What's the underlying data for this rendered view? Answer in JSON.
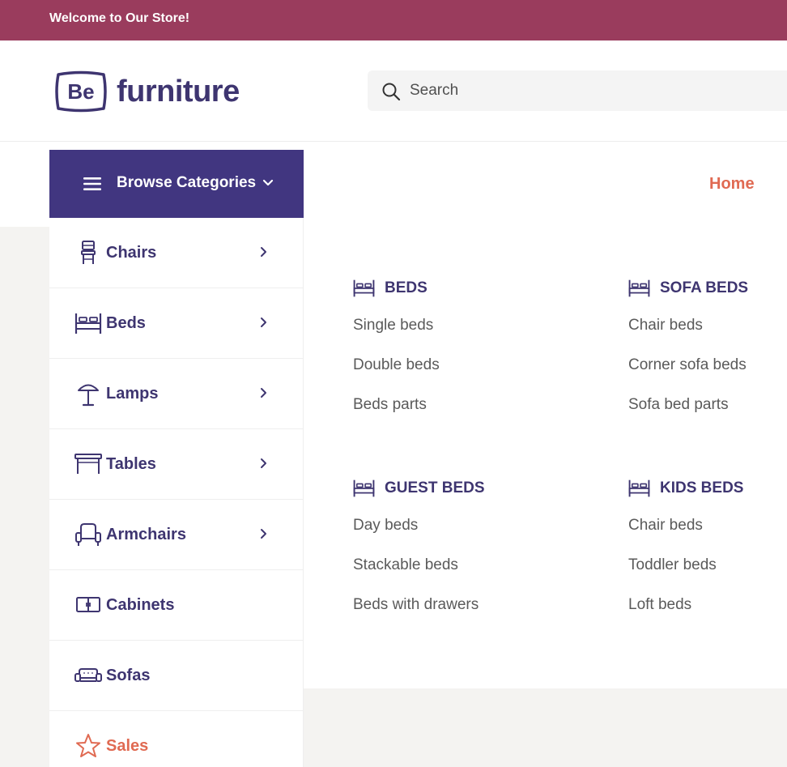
{
  "topbar": {
    "welcome": "Welcome to Our Store!"
  },
  "header": {
    "logo_badge": "Be",
    "logo_text": "furniture",
    "search": {
      "placeholder": "Search",
      "value": ""
    }
  },
  "nav": {
    "browse_label": "Browse Categories",
    "home_label": "Home"
  },
  "sidebar": {
    "items": [
      {
        "label": "Chairs",
        "icon": "chair-icon",
        "has_submenu": true
      },
      {
        "label": "Beds",
        "icon": "bed-icon",
        "has_submenu": true
      },
      {
        "label": "Lamps",
        "icon": "lamp-icon",
        "has_submenu": true
      },
      {
        "label": "Tables",
        "icon": "table-icon",
        "has_submenu": true
      },
      {
        "label": "Armchairs",
        "icon": "armchair-icon",
        "has_submenu": true
      },
      {
        "label": "Cabinets",
        "icon": "cabinet-icon",
        "has_submenu": false
      },
      {
        "label": "Sofas",
        "icon": "sofa-icon",
        "has_submenu": false
      },
      {
        "label": "Sales",
        "icon": "star-icon",
        "has_submenu": false
      }
    ]
  },
  "mega_menu": {
    "groups": [
      {
        "title": "BEDS",
        "links": [
          "Single beds",
          "Double beds",
          "Beds parts"
        ]
      },
      {
        "title": "SOFA BEDS",
        "links": [
          "Chair beds",
          "Corner sofa beds",
          "Sofa bed parts"
        ]
      },
      {
        "title": "GUEST BEDS",
        "links": [
          "Day beds",
          "Stackable beds",
          "Beds with drawers"
        ]
      },
      {
        "title": "KIDS BEDS",
        "links": [
          "Chair beds",
          "Toddler beds",
          "Loft beds"
        ]
      }
    ]
  },
  "colors": {
    "topbar": "#9a3c5d",
    "brand_purple": "#413680",
    "accent_coral": "#e06a52"
  }
}
